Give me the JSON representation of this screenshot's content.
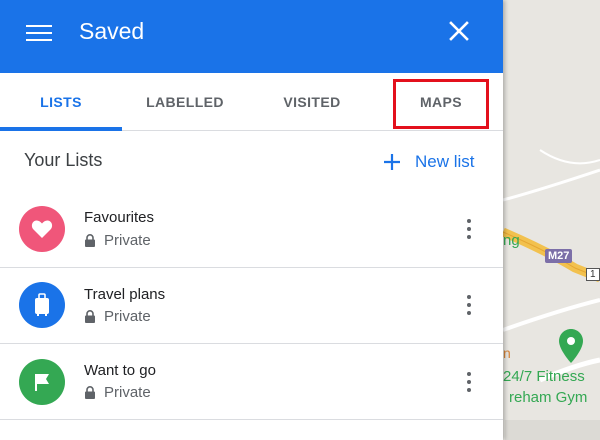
{
  "header": {
    "title": "Saved"
  },
  "tabs": [
    {
      "label": "LISTS",
      "active": true
    },
    {
      "label": "LABELLED",
      "active": false
    },
    {
      "label": "VISITED",
      "active": false
    },
    {
      "label": "MAPS",
      "active": false
    }
  ],
  "lists_header": {
    "title": "Your Lists",
    "new_list_label": "New list"
  },
  "lists": [
    {
      "name": "Favourites",
      "privacy": "Private",
      "icon": "heart-icon",
      "color": "#f0567a"
    },
    {
      "name": "Travel plans",
      "privacy": "Private",
      "icon": "suitcase-icon",
      "color": "#1a73e8"
    },
    {
      "name": "Want to go",
      "privacy": "Private",
      "icon": "flag-icon",
      "color": "#34a853"
    }
  ],
  "map": {
    "road_label": "M27",
    "place_fragment_1": "ng",
    "place_fragment_2": "24/7 Fitness",
    "place_fragment_3": "reham Gym",
    "place_fragment_4": "n",
    "road_number_fragment": "1"
  },
  "colors": {
    "accent": "#1a73e8",
    "highlight": "#e3101c"
  }
}
